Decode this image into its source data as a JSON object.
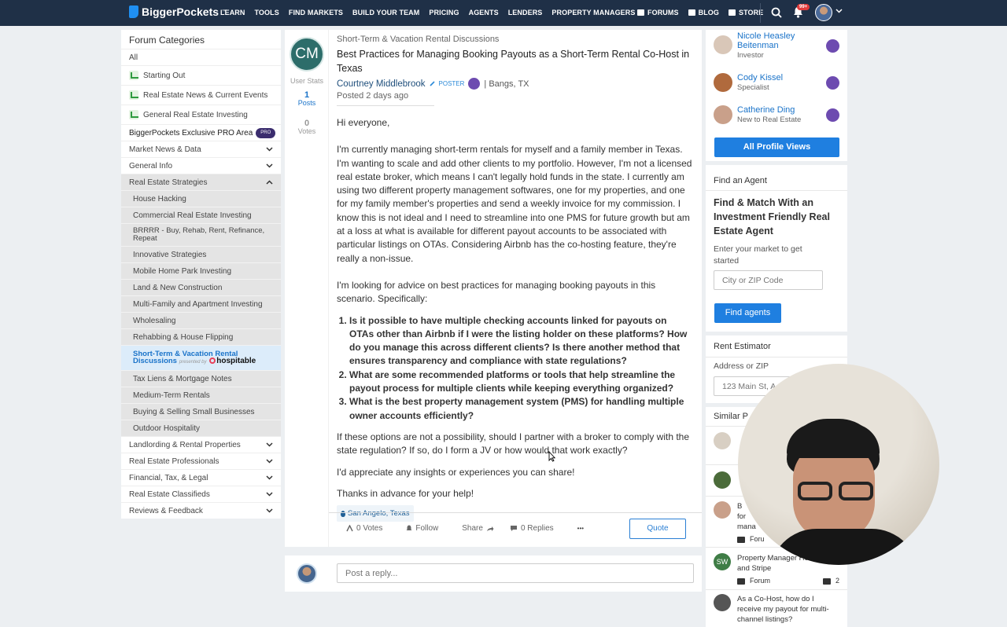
{
  "nav": {
    "logo": "BiggerPockets",
    "logo_tm": "™",
    "links": [
      "LEARN",
      "TOOLS",
      "FIND MARKETS",
      "BUILD YOUR TEAM",
      "PRICING",
      "AGENTS",
      "LENDERS",
      "PROPERTY MANAGERS"
    ],
    "right": [
      "FORUMS",
      "BLOG",
      "STORE"
    ],
    "notif_count": "99+"
  },
  "sidebar": {
    "title": "Forum Categories",
    "all": "All",
    "pinned": [
      "Starting Out",
      "Real Estate News & Current Events",
      "General Real Estate Investing"
    ],
    "pro_area": "BiggerPockets Exclusive PRO Area",
    "pro_badge": "PRO",
    "groups_top": [
      "Market News & Data",
      "General Info",
      "Real Estate Strategies"
    ],
    "strategies": [
      "House Hacking",
      "Commercial Real Estate Investing",
      "BRRRR - Buy, Rehab, Rent, Refinance, Repeat",
      "Innovative Strategies",
      "Mobile Home Park Investing",
      "Land & New Construction",
      "Multi-Family and Apartment Investing",
      "Wholesaling",
      "Rehabbing & House Flipping"
    ],
    "active": {
      "title": "Short-Term & Vacation Rental Discussions",
      "presented": "presented by",
      "sponsor": "hospitable"
    },
    "strategies_after": [
      "Tax Liens & Mortgage Notes",
      "Medium-Term Rentals",
      "Buying & Selling Small Businesses",
      "Outdoor Hospitality"
    ],
    "groups_bottom": [
      "Landlording & Rental Properties",
      "Real Estate Professionals",
      "Financial, Tax, & Legal",
      "Real Estate Classifieds",
      "Reviews & Feedback"
    ]
  },
  "post": {
    "avatar_initials": "CM",
    "user_stats": "User Stats",
    "posts_count": "1",
    "posts_label": "Posts",
    "votes_count": "0",
    "votes_label": "Votes",
    "category": "Short-Term & Vacation Rental Discussions",
    "title": "Best Practices for Managing Booking Payouts as a Short-Term Rental Co-Host in Texas",
    "author": "Courtney Middlebrook",
    "poster_tag": "POSTER",
    "location_inline": "| Bangs, TX",
    "posted": "Posted 2 days ago",
    "greeting": "Hi everyone,",
    "para1": "I'm currently managing short-term rentals for myself and a family member in Texas.  I'm wanting to scale and add other clients to my portfolio.  However, I'm not a licensed real estate broker, which means I can't legally hold funds in the state.  I currently am using two different property management softwares, one for my properties, and one for my family member's properties and send a weekly invoice for my commission.  I know this is not ideal and I need to streamline into one PMS for future growth but am at a loss at what is available for different payout accounts to be associated with particular listings on OTAs.  Considering Airbnb has the co-hosting feature, they're really a non-issue.",
    "para2": "I'm looking for advice on best practices for managing booking payouts in this scenario. Specifically:",
    "questions": [
      "Is it possible to have multiple checking accounts linked for payouts on OTAs other than Airbnb if I were the listing holder on these platforms? How do you manage this across different clients?  Is there another method that ensures transparency and compliance with state regulations?",
      "What are some recommended platforms or tools that help streamline the payout process for multiple clients while keeping everything organized?",
      "What is the best property management system (PMS) for handling multiple owner accounts efficiently?"
    ],
    "para3": "If these options are not a possibility, should I partner with a broker to comply with the state regulation? If so, do I form a JV or how would that work exactly?",
    "para4": "I'd appreciate any insights or experiences you can share!",
    "para5": "Thanks in advance for your help!",
    "location_tag": "San Angelo, Texas",
    "votes_action": "0 Votes",
    "follow_action": "Follow",
    "share_action": "Share",
    "replies_action": "0 Replies",
    "more": "•••",
    "quote": "Quote"
  },
  "reply": {
    "placeholder": "Post a reply..."
  },
  "right": {
    "profile_views": [
      {
        "name": "Nicole Heasley Beitenman",
        "role": "Investor",
        "color": "#d9c7b8"
      },
      {
        "name": "Cody Kissel",
        "role": "Specialist",
        "color": "#b06a3d"
      },
      {
        "name": "Catherine Ding",
        "role": "New to Real Estate",
        "color": "#c9a08a"
      }
    ],
    "all_views_btn": "All Profile Views",
    "agent_section": "Find an Agent",
    "agent_title": "Find & Match With an Investment Friendly Real Estate Agent",
    "agent_desc": "Enter your market to get started",
    "agent_input_placeholder": "City or ZIP Code",
    "agent_btn": "Find agents",
    "rent_section": "Rent Estimator",
    "rent_label": "Address or ZIP",
    "rent_placeholder": "123 Main St, A",
    "similar_section": "Similar P",
    "similar_frag1": "B",
    "similar_frag2": "for",
    "similar_frag3": "mana",
    "similar_frag4": "Foru",
    "similar_sw": {
      "initials": "SW",
      "title": "Property Manager Hostaway and Stripe",
      "meta": "Forum",
      "count": "2"
    },
    "similar_last": {
      "title": "As a Co-Host, how do I receive my payout for multi-channel listings?"
    }
  }
}
